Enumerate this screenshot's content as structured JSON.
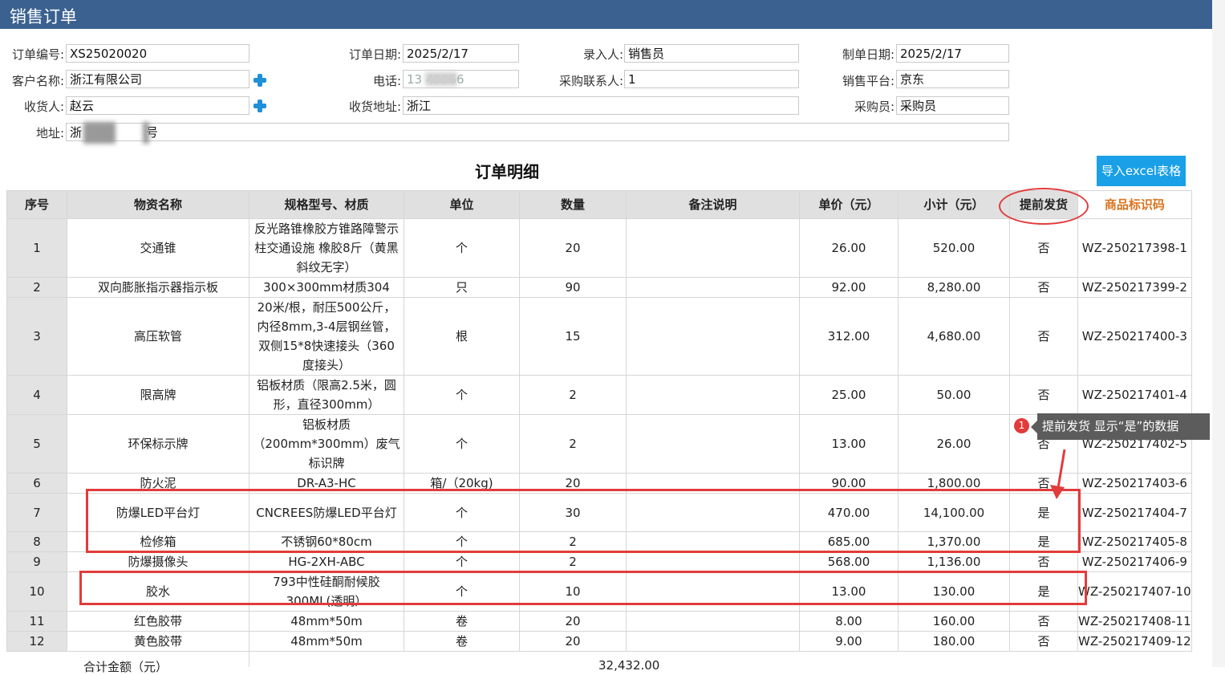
{
  "window": {
    "title": "销售订单"
  },
  "form": {
    "order_no_label": "订单编号:",
    "order_no": "XS25020020",
    "order_date_label": "订单日期:",
    "order_date": "2025/2/17",
    "entry_label": "录入人:",
    "entry": "销售员",
    "make_date_label": "制单日期:",
    "make_date": "2025/2/17",
    "customer_label": "客户名称:",
    "customer": "浙江有限公司",
    "phone_label": "电话:",
    "phone": "13    45566",
    "buyer_contact_label": "采购联系人:",
    "buyer_contact": "1",
    "platform_label": "销售平台:",
    "platform": "京东",
    "receiver_label": "收货人:",
    "receiver": "赵云",
    "ship_addr_label": "收货地址:",
    "ship_addr": "浙江",
    "buyer_label": "采购员:",
    "buyer": "采购员",
    "address_label": "地址:",
    "address_pre": "浙",
    "address_post": "号"
  },
  "detail": {
    "title": "订单明细",
    "import_button": "导入excel表格",
    "headers": [
      "序号",
      "物资名称",
      "规格型号、材质",
      "单位",
      "数量",
      "备注说明",
      "单价（元）",
      "小计（元）",
      "提前发货",
      "商品标识码"
    ],
    "rows": [
      [
        "1",
        "交通锥",
        "反光路锥橡胶方锥路障警示柱交通设施 橡胶8斤（黄黑斜纹无字）",
        "个",
        "20",
        "",
        "26.00",
        "520.00",
        "否",
        "WZ-250217398-1"
      ],
      [
        "2",
        "双向膨胀指示器指示板",
        "300×300mm材质304",
        "只",
        "90",
        "",
        "92.00",
        "8,280.00",
        "否",
        "WZ-250217399-2"
      ],
      [
        "3",
        "高压软管",
        "20米/根，耐压500公斤，内径8mm,3-4层钢丝管，双侧15*8快速接头（360度接头）",
        "根",
        "15",
        "",
        "312.00",
        "4,680.00",
        "否",
        "WZ-250217400-3"
      ],
      [
        "4",
        "限高牌",
        "铝板材质（限高2.5米，圆形，直径300mm）",
        "个",
        "2",
        "",
        "25.00",
        "50.00",
        "否",
        "WZ-250217401-4"
      ],
      [
        "5",
        "环保标示牌",
        "铝板材质（200mm*300mm）废气标识牌",
        "个",
        "2",
        "",
        "13.00",
        "26.00",
        "否",
        "WZ-250217402-5"
      ],
      [
        "6",
        "防火泥",
        "DR-A3-HC",
        "箱/（20kg)",
        "20",
        "",
        "90.00",
        "1,800.00",
        "否",
        "WZ-250217403-6"
      ],
      [
        "7",
        "防爆LED平台灯",
        "CNCREES防爆LED平台灯",
        "个",
        "30",
        "",
        "470.00",
        "14,100.00",
        "是",
        "WZ-250217404-7"
      ],
      [
        "8",
        "检修箱",
        "不锈钢60*80cm",
        "个",
        "2",
        "",
        "685.00",
        "1,370.00",
        "是",
        "WZ-250217405-8"
      ],
      [
        "9",
        "防爆摄像头",
        "HG-2XH-ABC",
        "个",
        "2",
        "",
        "568.00",
        "1,136.00",
        "否",
        "WZ-250217406-9"
      ],
      [
        "10",
        "胶水",
        "793中性硅酮耐候胶300ML(透明）",
        "个",
        "10",
        "",
        "13.00",
        "130.00",
        "是",
        "WZ-250217407-10"
      ],
      [
        "11",
        "红色胶带",
        "48mm*50m",
        "卷",
        "20",
        "",
        "8.00",
        "160.00",
        "否",
        "WZ-250217408-11"
      ],
      [
        "12",
        "黄色胶带",
        "48mm*50m",
        "卷",
        "20",
        "",
        "9.00",
        "180.00",
        "否",
        "WZ-250217409-12"
      ]
    ],
    "total_label": "合计金额（元）",
    "total_value": "32,432.00"
  },
  "annotation": {
    "badge": "1",
    "tooltip": "提前发货 显示“是”的数据",
    "color": "#e23b3b"
  }
}
